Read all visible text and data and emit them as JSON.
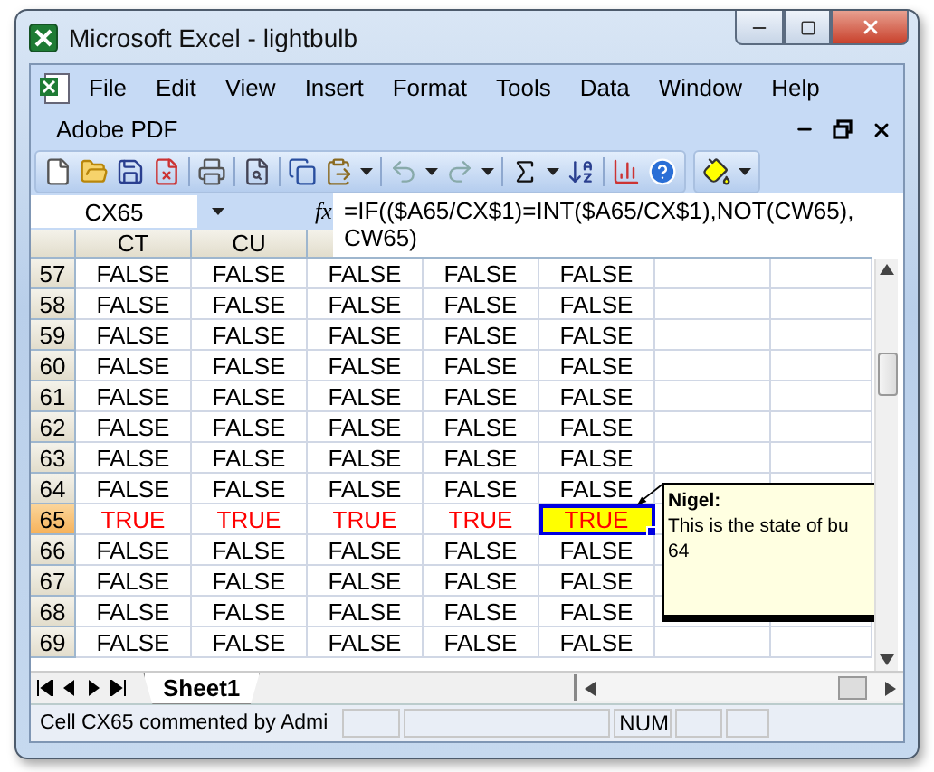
{
  "window": {
    "title": "Microsoft Excel - lightbulb"
  },
  "menus": [
    {
      "label": "File",
      "selected": false
    },
    {
      "label": "Edit",
      "selected": false
    },
    {
      "label": "View",
      "selected": false
    },
    {
      "label": "Insert",
      "selected": false
    },
    {
      "label": "Format",
      "selected": false
    },
    {
      "label": "Tools",
      "selected": false
    },
    {
      "label": "Data",
      "selected": false
    },
    {
      "label": "Window",
      "selected": false
    },
    {
      "label": "Help",
      "selected": false
    }
  ],
  "menu_row_2": "Adobe PDF",
  "name_box": "CX65",
  "fx_label": "fx",
  "formula": "=IF(($A65/CX$1)=INT($A65/CX$1),NOT(CW65), CW65)",
  "columns": [
    "CT",
    "CU"
  ],
  "rows": [
    {
      "header": "57",
      "selected": false,
      "cells": [
        {
          "text": "FALSE",
          "selected": false
        },
        {
          "text": "FALSE",
          "selected": false
        },
        {
          "text": "FALSE",
          "selected": false
        },
        {
          "text": "FALSE",
          "selected": false
        },
        {
          "text": "FALSE",
          "selected": false
        }
      ]
    },
    {
      "header": "58",
      "selected": false,
      "cells": [
        {
          "text": "FALSE",
          "selected": false
        },
        {
          "text": "FALSE",
          "selected": false
        },
        {
          "text": "FALSE",
          "selected": false
        },
        {
          "text": "FALSE",
          "selected": false
        },
        {
          "text": "FALSE",
          "selected": false
        }
      ]
    },
    {
      "header": "59",
      "selected": false,
      "cells": [
        {
          "text": "FALSE",
          "selected": false
        },
        {
          "text": "FALSE",
          "selected": false
        },
        {
          "text": "FALSE",
          "selected": false
        },
        {
          "text": "FALSE",
          "selected": false
        },
        {
          "text": "FALSE",
          "selected": false
        }
      ]
    },
    {
      "header": "60",
      "selected": false,
      "cells": [
        {
          "text": "FALSE",
          "selected": false
        },
        {
          "text": "FALSE",
          "selected": false
        },
        {
          "text": "FALSE",
          "selected": false
        },
        {
          "text": "FALSE",
          "selected": false
        },
        {
          "text": "FALSE",
          "selected": false
        }
      ]
    },
    {
      "header": "61",
      "selected": false,
      "cells": [
        {
          "text": "FALSE",
          "selected": false
        },
        {
          "text": "FALSE",
          "selected": false
        },
        {
          "text": "FALSE",
          "selected": false
        },
        {
          "text": "FALSE",
          "selected": false
        },
        {
          "text": "FALSE",
          "selected": false
        }
      ]
    },
    {
      "header": "62",
      "selected": false,
      "cells": [
        {
          "text": "FALSE",
          "selected": false
        },
        {
          "text": "FALSE",
          "selected": false
        },
        {
          "text": "FALSE",
          "selected": false
        },
        {
          "text": "FALSE",
          "selected": false
        },
        {
          "text": "FALSE",
          "selected": false
        }
      ]
    },
    {
      "header": "63",
      "selected": false,
      "cells": [
        {
          "text": "FALSE",
          "selected": false
        },
        {
          "text": "FALSE",
          "selected": false
        },
        {
          "text": "FALSE",
          "selected": false
        },
        {
          "text": "FALSE",
          "selected": false
        },
        {
          "text": "FALSE",
          "selected": false
        }
      ]
    },
    {
      "header": "64",
      "selected": false,
      "cells": [
        {
          "text": "FALSE",
          "selected": false
        },
        {
          "text": "FALSE",
          "selected": false
        },
        {
          "text": "FALSE",
          "selected": false
        },
        {
          "text": "FALSE",
          "selected": false
        },
        {
          "text": "FALSE",
          "selected": false
        }
      ]
    },
    {
      "header": "65",
      "selected": true,
      "cells": [
        {
          "text": "TRUE",
          "selected": false
        },
        {
          "text": "TRUE",
          "selected": false
        },
        {
          "text": "TRUE",
          "selected": false
        },
        {
          "text": "TRUE",
          "selected": false
        },
        {
          "text": "TRUE",
          "selected": true
        }
      ]
    },
    {
      "header": "66",
      "selected": false,
      "cells": [
        {
          "text": "FALSE",
          "selected": false
        },
        {
          "text": "FALSE",
          "selected": false
        },
        {
          "text": "FALSE",
          "selected": false
        },
        {
          "text": "FALSE",
          "selected": false
        },
        {
          "text": "FALSE",
          "selected": false
        }
      ]
    },
    {
      "header": "67",
      "selected": false,
      "cells": [
        {
          "text": "FALSE",
          "selected": false
        },
        {
          "text": "FALSE",
          "selected": false
        },
        {
          "text": "FALSE",
          "selected": false
        },
        {
          "text": "FALSE",
          "selected": false
        },
        {
          "text": "FALSE",
          "selected": false
        }
      ]
    },
    {
      "header": "68",
      "selected": false,
      "cells": [
        {
          "text": "FALSE",
          "selected": false
        },
        {
          "text": "FALSE",
          "selected": false
        },
        {
          "text": "FALSE",
          "selected": false
        },
        {
          "text": "FALSE",
          "selected": false
        },
        {
          "text": "FALSE",
          "selected": false
        }
      ]
    },
    {
      "header": "69",
      "selected": false,
      "cells": [
        {
          "text": "FALSE",
          "selected": false
        },
        {
          "text": "FALSE",
          "selected": false
        },
        {
          "text": "FALSE",
          "selected": false
        },
        {
          "text": "FALSE",
          "selected": false
        },
        {
          "text": "FALSE",
          "selected": false
        }
      ]
    }
  ],
  "comment": {
    "author": "Nigel:",
    "lines": [
      "This is the state of bu",
      "64"
    ]
  },
  "sheet_tabs": [
    {
      "label": "Sheet1",
      "selected": true
    }
  ],
  "status_bar": {
    "message": "Cell CX65 commented by Admi",
    "indicator": "NUM"
  }
}
